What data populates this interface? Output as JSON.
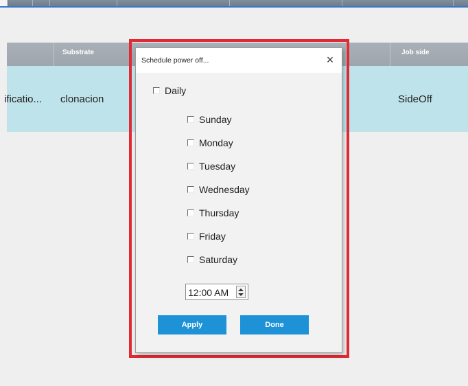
{
  "grid": {
    "headers": [
      "Substrate",
      "Job side"
    ],
    "row": {
      "col1": "ificatio...",
      "col2": "clonacion",
      "dot": ".",
      "col_job_side": "SideOff"
    }
  },
  "dialog": {
    "title": "Schedule power off...",
    "close_icon": "×",
    "daily_label": "Daily",
    "days": [
      "Sunday",
      "Monday",
      "Tuesday",
      "Wednesday",
      "Thursday",
      "Friday",
      "Saturday"
    ],
    "time_value": "12:00 AM",
    "apply_label": "Apply",
    "done_label": "Done"
  },
  "colors": {
    "accent_button": "#1d92d6",
    "highlight_frame": "#e02a36",
    "row_selected": "#bfe3ea",
    "header": "#a9b0b7"
  },
  "icons": {
    "close": "close-icon",
    "spin_up": "arrow-up-icon",
    "spin_down": "arrow-down-icon"
  }
}
